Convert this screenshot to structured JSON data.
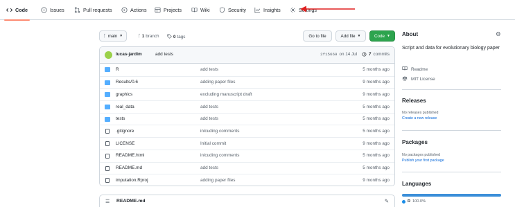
{
  "tabs": [
    {
      "label": "Code",
      "icon": "code-icon",
      "selected": true
    },
    {
      "label": "Issues",
      "icon": "issue-icon"
    },
    {
      "label": "Pull requests",
      "icon": "pull-request-icon"
    },
    {
      "label": "Actions",
      "icon": "play-icon"
    },
    {
      "label": "Projects",
      "icon": "table-icon"
    },
    {
      "label": "Wiki",
      "icon": "book-icon"
    },
    {
      "label": "Security",
      "icon": "shield-icon"
    },
    {
      "label": "Insights",
      "icon": "graph-icon"
    },
    {
      "label": "Settings",
      "icon": "gear-icon"
    }
  ],
  "toolbar": {
    "branch": "main",
    "branch_count": "1",
    "branch_word": "branch",
    "tag_count": "0",
    "tag_word": "tags",
    "goto_file": "Go to file",
    "add_file": "Add file",
    "code": "Code"
  },
  "commit": {
    "author": "lucas-jardim",
    "message": "add tests",
    "sha": "2f15669",
    "date": "on 14 Jul",
    "count": "7",
    "count_word": "commits"
  },
  "files": [
    {
      "type": "folder",
      "name": "R",
      "message": "add tests",
      "time": "5 months ago"
    },
    {
      "type": "folder",
      "name": "Results/0.6",
      "message": "adding paper files",
      "time": "9 months ago"
    },
    {
      "type": "folder",
      "name": "graphics",
      "message": "excluding manuscript draft",
      "time": "9 months ago"
    },
    {
      "type": "folder",
      "name": "real_data",
      "message": "add tests",
      "time": "5 months ago"
    },
    {
      "type": "folder",
      "name": "tests",
      "message": "add tests",
      "time": "5 months ago"
    },
    {
      "type": "file",
      "name": ".gitignore",
      "message": "inlcuding comments",
      "time": "5 months ago"
    },
    {
      "type": "file",
      "name": "LICENSE",
      "message": "Initial commit",
      "time": "9 months ago"
    },
    {
      "type": "file",
      "name": "README.html",
      "message": "inlcuding comments",
      "time": "5 months ago"
    },
    {
      "type": "file",
      "name": "README.md",
      "message": "add tests",
      "time": "5 months ago"
    },
    {
      "type": "file",
      "name": "imputation.Rproj",
      "message": "adding paper files",
      "time": "9 months ago"
    }
  ],
  "readme": {
    "filename": "README.md"
  },
  "about": {
    "heading": "About",
    "description": "Script and data for evolutionary biology paper",
    "readme": "Readme",
    "license": "MIT License"
  },
  "releases": {
    "heading": "Releases",
    "none": "No releases published",
    "create": "Create a new release"
  },
  "packages": {
    "heading": "Packages",
    "none": "No packages published",
    "publish": "Publish your first package"
  },
  "languages": {
    "heading": "Languages",
    "items": [
      {
        "name": "R",
        "percent": "100.0%",
        "color": "#198ce7"
      }
    ]
  },
  "colors": {
    "accent_tab_underline": "#fd8c73",
    "primary_button": "#2da44e",
    "folder": "#54aeff",
    "link": "#0969da",
    "annotation_arrow": "#e02020"
  }
}
